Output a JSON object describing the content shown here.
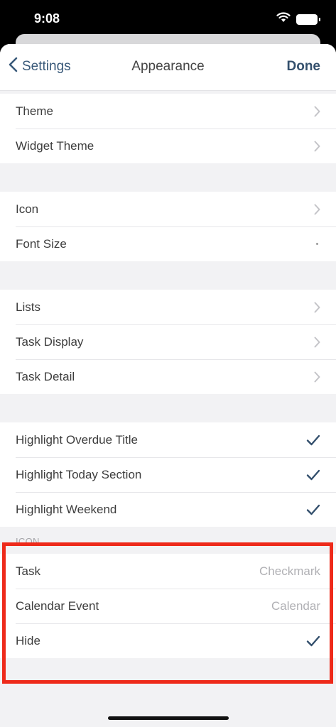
{
  "status_bar": {
    "time": "9:08"
  },
  "nav": {
    "back_label": "Settings",
    "title": "Appearance",
    "done_label": "Done"
  },
  "groups": [
    {
      "rows": [
        {
          "label": "Theme",
          "accessory": "chevron"
        },
        {
          "label": "Widget Theme",
          "accessory": "chevron"
        }
      ]
    },
    {
      "rows": [
        {
          "label": "Icon",
          "accessory": "chevron"
        },
        {
          "label": "Font Size",
          "accessory": "dot"
        }
      ]
    },
    {
      "rows": [
        {
          "label": "Lists",
          "accessory": "chevron"
        },
        {
          "label": "Task Display",
          "accessory": "chevron"
        },
        {
          "label": "Task Detail",
          "accessory": "chevron"
        }
      ]
    },
    {
      "rows": [
        {
          "label": "Highlight Overdue Title",
          "accessory": "checkmark"
        },
        {
          "label": "Highlight Today Section",
          "accessory": "checkmark"
        },
        {
          "label": "Highlight Weekend",
          "accessory": "checkmark"
        }
      ]
    }
  ],
  "icon_section": {
    "header": "ICON",
    "rows": [
      {
        "label": "Task",
        "value": "Checkmark"
      },
      {
        "label": "Calendar Event",
        "value": "Calendar"
      },
      {
        "label": "Hide",
        "accessory": "checkmark"
      }
    ]
  },
  "colors": {
    "accent": "#34506d",
    "highlight_box": "#ee2a1a",
    "secondary_text": "#b0b0b4"
  }
}
